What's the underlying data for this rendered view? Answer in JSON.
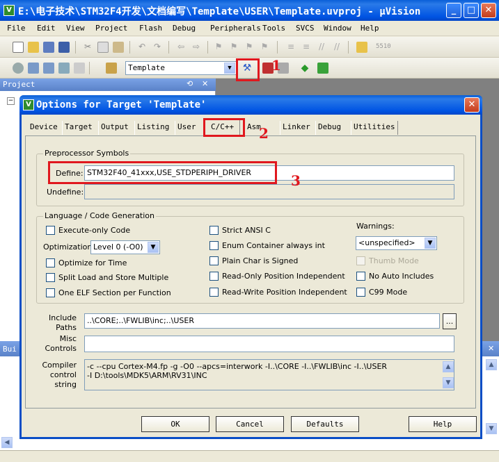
{
  "window": {
    "title": "E:\\电子技术\\STM32F4开发\\文档编写\\Template\\USER\\Template.uvproj - µVision",
    "min": "_",
    "max": "□",
    "close": "✕"
  },
  "menu": [
    "File",
    "Edit",
    "View",
    "Project",
    "Flash",
    "Debug",
    "Peripherals",
    "Tools",
    "SVCS",
    "Window",
    "Help"
  ],
  "toolbar": {
    "find_value": "5510",
    "target_select": "Template"
  },
  "panels": {
    "project": "Project",
    "build": "Bui"
  },
  "dialog": {
    "title": "Options for Target 'Template'",
    "tabs": [
      "Device",
      "Target",
      "Output",
      "Listing",
      "User",
      "C/C++",
      "Asm",
      "Linker",
      "Debug",
      "Utilities"
    ],
    "active_tab": "C/C++",
    "preprocessor": {
      "group_label": "Preprocessor Symbols",
      "define_label": "Define:",
      "define_value": "STM32F40_41xxx,USE_STDPERIPH_DRIVER",
      "undefine_label": "Undefine:",
      "undefine_value": ""
    },
    "language": {
      "group_label": "Language / Code Generation",
      "execute_only": "Execute-only Code",
      "optimization_label": "Optimization:",
      "optimization_value": "Level 0 (-O0)",
      "optimize_time": "Optimize for Time",
      "split_load": "Split Load and Store Multiple",
      "one_elf": "One ELF Section per Function",
      "strict_ansi": "Strict ANSI C",
      "enum_container": "Enum Container always int",
      "plain_char": "Plain Char is Signed",
      "ro_pi": "Read-Only Position Independent",
      "rw_pi": "Read-Write Position Independent",
      "warnings_label": "Warnings:",
      "warnings_value": "<unspecified>",
      "thumb_mode": "Thumb Mode",
      "no_auto_includes": "No Auto Includes",
      "c99_mode": "C99 Mode"
    },
    "include_label_1": "Include",
    "include_label_2": "Paths",
    "include_value": "..\\CORE;..\\FWLIB\\inc;..\\USER",
    "browse": "...",
    "misc_label_1": "Misc",
    "misc_label_2": "Controls",
    "misc_value": "",
    "compiler_label_1": "Compiler",
    "compiler_label_2": "control",
    "compiler_label_3": "string",
    "compiler_line1": "-c --cpu Cortex-M4.fp -g -O0 --apcs=interwork -I..\\CORE -I..\\FWLIB\\inc -I..\\USER",
    "compiler_line2": "-I D:\\tools\\MDK5\\ARM\\RV31\\INC",
    "buttons": {
      "ok": "OK",
      "cancel": "Cancel",
      "defaults": "Defaults",
      "help": "Help"
    }
  },
  "annotations": {
    "n1": "1",
    "n2": "2",
    "n3": "3"
  },
  "colors": {
    "annotation_red": "#e0181e",
    "titlebar_blue": "#0054e3",
    "xp_beige": "#ece9d8"
  }
}
